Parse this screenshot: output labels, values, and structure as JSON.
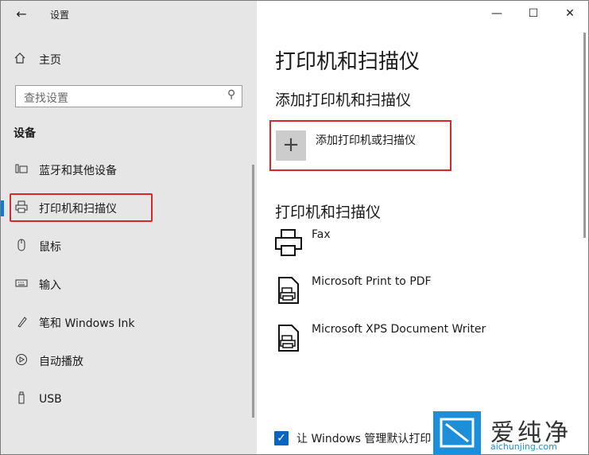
{
  "window": {
    "app_title": "设置"
  },
  "sidebar": {
    "back_label": "←",
    "home_label": "主页",
    "search_placeholder": "查找设置",
    "section_heading": "设备",
    "items": [
      {
        "label": "蓝牙和其他设备",
        "icon": "bluetooth-devices-icon"
      },
      {
        "label": "打印机和扫描仪",
        "icon": "printer-icon",
        "selected": true
      },
      {
        "label": "鼠标",
        "icon": "mouse-icon"
      },
      {
        "label": "输入",
        "icon": "keyboard-icon"
      },
      {
        "label": "笔和 Windows Ink",
        "icon": "pen-icon"
      },
      {
        "label": "自动播放",
        "icon": "autoplay-icon"
      },
      {
        "label": "USB",
        "icon": "usb-icon"
      }
    ]
  },
  "caption_buttons": {
    "minimize": "—",
    "maximize": "☐",
    "close": "✕"
  },
  "main": {
    "title": "打印机和扫描仪",
    "add_section_heading": "添加打印机和扫描仪",
    "add_button_label": "添加打印机或扫描仪",
    "list_heading": "打印机和扫描仪",
    "printers": [
      {
        "name": "Fax"
      },
      {
        "name": "Microsoft Print to PDF"
      },
      {
        "name": "Microsoft XPS Document Writer"
      }
    ],
    "default_printer_checkbox": {
      "label": "让 Windows 管理默认打印",
      "checked": true
    }
  },
  "watermark": {
    "text": "爱纯净",
    "url": "aichunjing.com"
  },
  "colors": {
    "accent": "#0a7bd6",
    "highlight_border": "#d9262b",
    "sidebar_bg": "#e6e6e6"
  }
}
